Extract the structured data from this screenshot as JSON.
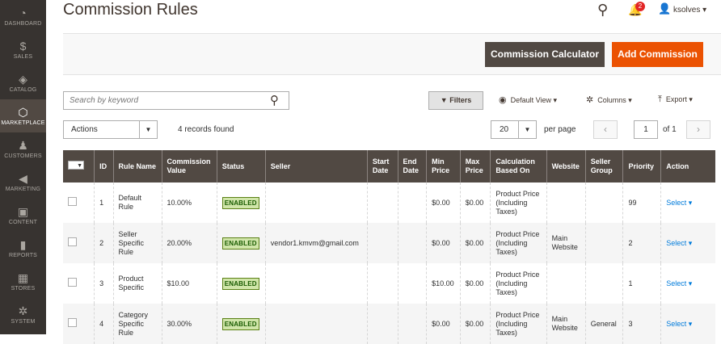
{
  "sidebar": {
    "items": [
      {
        "label": "DASHBOARD",
        "icon": "dashboard-icon",
        "glyph": "◔"
      },
      {
        "label": "SALES",
        "icon": "dollar-icon",
        "glyph": "$"
      },
      {
        "label": "CATALOG",
        "icon": "cube-icon",
        "glyph": "◈"
      },
      {
        "label": "MARKETPLACE",
        "icon": "hexagon-icon",
        "glyph": "⬡"
      },
      {
        "label": "CUSTOMERS",
        "icon": "person-icon",
        "glyph": "♟"
      },
      {
        "label": "MARKETING",
        "icon": "megaphone-icon",
        "glyph": "◀"
      },
      {
        "label": "CONTENT",
        "icon": "content-icon",
        "glyph": "▣"
      },
      {
        "label": "REPORTS",
        "icon": "bar-chart-icon",
        "glyph": "▮"
      },
      {
        "label": "STORES",
        "icon": "store-icon",
        "glyph": "▦"
      },
      {
        "label": "SYSTEM",
        "icon": "gear-icon",
        "glyph": "✲"
      }
    ]
  },
  "header": {
    "title": "Commission Rules",
    "notification_count": "2",
    "username": "ksolves"
  },
  "toolbar": {
    "calc_label": "Commission Calculator",
    "add_label": "Add Commission"
  },
  "grid_controls": {
    "search_placeholder": "Search by keyword",
    "filters_label": "Filters",
    "view_label": "Default View",
    "columns_label": "Columns",
    "export_label": "Export",
    "actions_label": "Actions",
    "records_found": "4 records found",
    "per_page_value": "20",
    "per_page_label": "per page",
    "page_value": "1",
    "page_of": "of 1"
  },
  "table": {
    "headers": [
      "ID",
      "Rule Name",
      "Commission Value",
      "Status",
      "Seller",
      "Start Date",
      "End Date",
      "Min Price",
      "Max Price",
      "Calculation Based On",
      "Website",
      "Seller Group",
      "Priority",
      "Action"
    ],
    "rows": [
      {
        "id": "1",
        "name": "Default Rule",
        "value": "10.00%",
        "status": "ENABLED",
        "seller": "",
        "start": "",
        "end": "",
        "min": "$0.00",
        "max": "$0.00",
        "calc": "Product Price (Including Taxes)",
        "website": "",
        "group": "",
        "priority": "99",
        "action": "Select"
      },
      {
        "id": "2",
        "name": "Seller Specific Rule",
        "value": "20.00%",
        "status": "ENABLED",
        "seller": "vendor1.kmvm@gmail.com",
        "start": "",
        "end": "",
        "min": "$0.00",
        "max": "$0.00",
        "calc": "Product Price (Including Taxes)",
        "website": "Main Website",
        "group": "",
        "priority": "2",
        "action": "Select"
      },
      {
        "id": "3",
        "name": "Product Specific",
        "value": "$10.00",
        "status": "ENABLED",
        "seller": "",
        "start": "",
        "end": "",
        "min": "$10.00",
        "max": "$0.00",
        "calc": "Product Price (Including Taxes)",
        "website": "",
        "group": "",
        "priority": "1",
        "action": "Select"
      },
      {
        "id": "4",
        "name": "Category Specific Rule",
        "value": "30.00%",
        "status": "ENABLED",
        "seller": "",
        "start": "",
        "end": "",
        "min": "$0.00",
        "max": "$0.00",
        "calc": "Product Price (Including Taxes)",
        "website": "Main Website",
        "group": "General",
        "priority": "3",
        "action": "Select"
      }
    ]
  },
  "colors": {
    "sidebar_bg": "#373330",
    "accent_orange": "#eb5202",
    "header_row_bg": "#514943",
    "link_blue": "#007bdb"
  }
}
